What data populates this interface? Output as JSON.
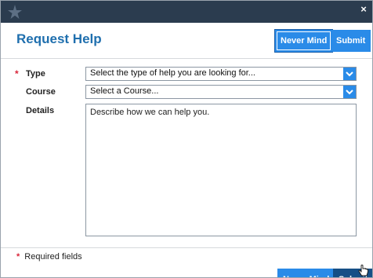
{
  "titlebar": {
    "logo_icon": "star-logo-icon",
    "close_label": "×"
  },
  "header": {
    "title": "Request Help",
    "buttons": {
      "never_mind": "Never Mind",
      "submit": "Submit"
    }
  },
  "form": {
    "type": {
      "label": "Type",
      "required_marker": "*",
      "value": "Select the type of help you are looking for..."
    },
    "course": {
      "label": "Course",
      "value": "Select a Course..."
    },
    "details": {
      "label": "Details",
      "placeholder": "Describe how we can help you."
    }
  },
  "footer": {
    "required_marker": "*",
    "required_text": "Required fields",
    "buttons": {
      "never_mind": "Never Mind",
      "submit": "Submit"
    }
  },
  "colors": {
    "titlebar": "#2b3c4f",
    "title_text": "#1f6fae",
    "button_primary": "#2a8be8",
    "button_dark": "#164f86",
    "required": "#d9263a"
  }
}
